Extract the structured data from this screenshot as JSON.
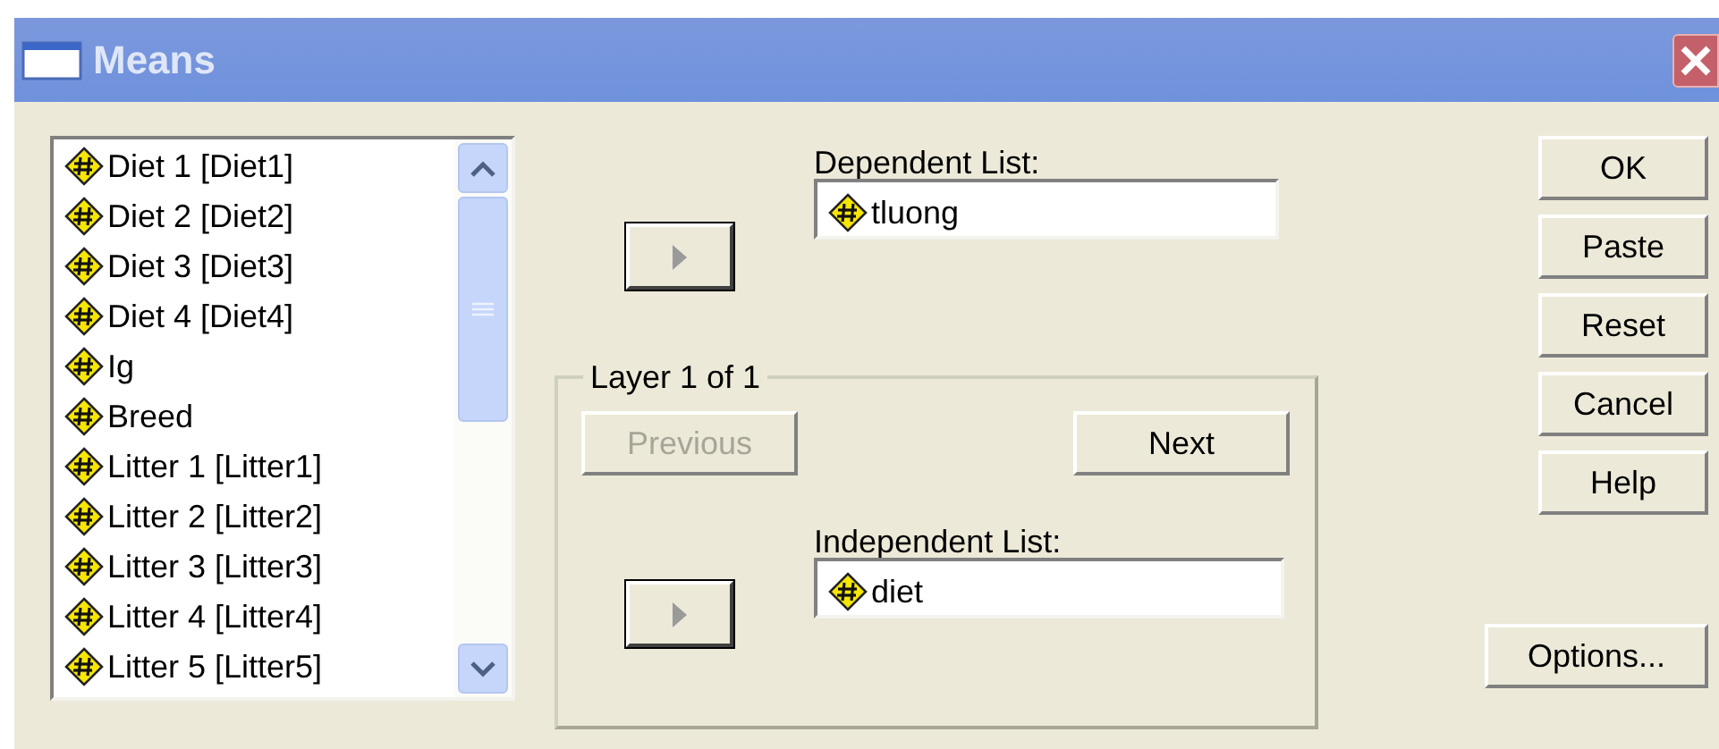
{
  "window": {
    "title": "Means"
  },
  "variables": [
    "Diet 1 [Diet1]",
    "Diet 2 [Diet2]",
    "Diet 3 [Diet3]",
    "Diet 4 [Diet4]",
    "Ig",
    "Breed",
    "Litter 1 [Litter1]",
    "Litter 2 [Litter2]",
    "Litter 3 [Litter3]",
    "Litter 4 [Litter4]",
    "Litter 5 [Litter5]"
  ],
  "dependent_list": {
    "label": "Dependent List:",
    "items": [
      "tluong"
    ]
  },
  "layer": {
    "title": "Layer 1 of 1",
    "previous": {
      "label": "Previous",
      "disabled": true
    },
    "next": {
      "label": "Next",
      "disabled": false
    },
    "independent_list": {
      "label": "Independent List:",
      "items": [
        "diet"
      ]
    }
  },
  "buttons": [
    "OK",
    "Paste",
    "Reset",
    "Cancel",
    "Help"
  ],
  "options_button": "Options..."
}
